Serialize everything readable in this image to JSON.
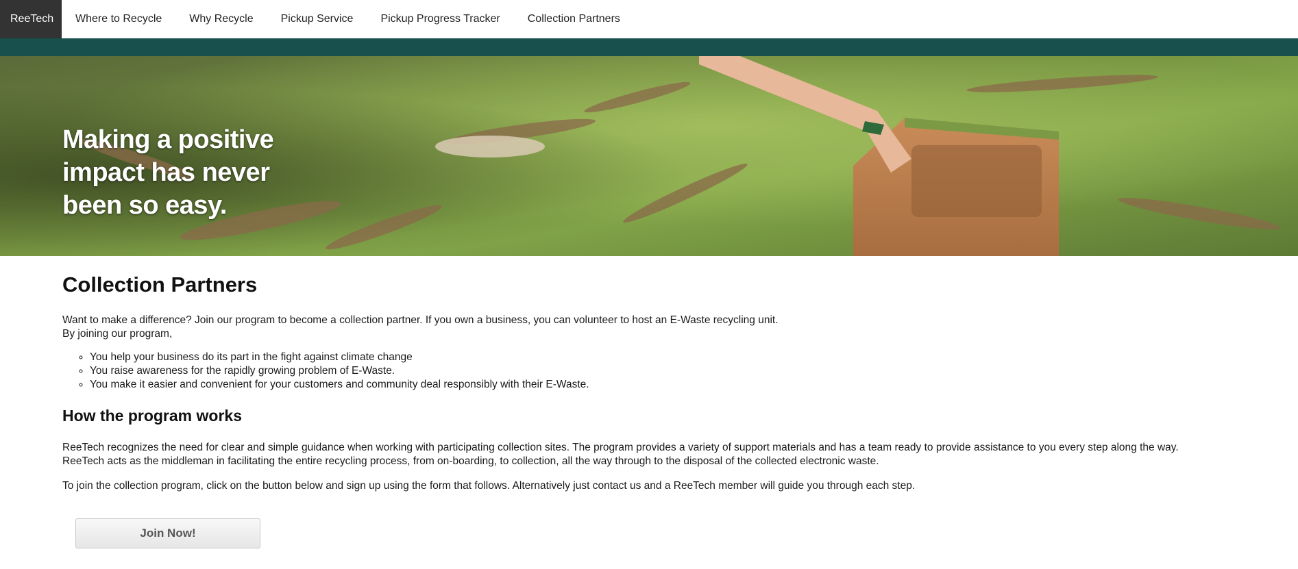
{
  "nav": {
    "brand": "ReeTech",
    "items": [
      {
        "label": "Where to Recycle"
      },
      {
        "label": "Why Recycle"
      },
      {
        "label": "Pickup Service"
      },
      {
        "label": "Pickup Progress Tracker"
      },
      {
        "label": "Collection Partners"
      }
    ]
  },
  "colors": {
    "nav_brand_bg": "#333333",
    "accent_bar": "#17504c"
  },
  "hero": {
    "headline": "Making a positive impact has never been so easy."
  },
  "main": {
    "title": "Collection Partners",
    "intro_line1": "Want to make a difference? Join our program to become a collection partner. If you own a business, you can volunteer to host an E-Waste recycling unit.",
    "intro_line2": "By joining our program,",
    "benefits": [
      "You help your business do its part in the fight against climate change",
      "You raise awareness for the rapidly growing problem of E-Waste.",
      "You make it easier and convenient for your customers and community deal responsibly with their E-Waste."
    ],
    "how_title": "How the program works",
    "how_line1": "ReeTech recognizes the need for clear and simple guidance when working with participating collection sites. The program provides a variety of support materials and has a team ready to provide assistance to you every step along the way.",
    "how_line2": "ReeTech acts as the middleman in facilitating the entire recycling process, from on-boarding, to collection, all the way through to the disposal of the collected electronic waste.",
    "join_text": "To join the collection program, click on the button below and sign up using the form that follows. Alternatively just contact us and a ReeTech member will guide you through each step.",
    "join_button": "Join Now!"
  }
}
